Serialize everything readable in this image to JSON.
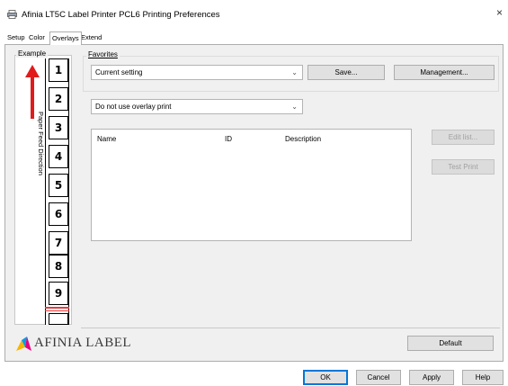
{
  "window": {
    "title": "Afinia LT5C Label Printer PCL6 Printing Preferences",
    "close_glyph": "×",
    "icon": "printer-icon"
  },
  "tabs": [
    {
      "label": "Setup",
      "active": false
    },
    {
      "label": "Color",
      "active": false
    },
    {
      "label": "Overlays",
      "active": true
    },
    {
      "label": "Extend",
      "active": false
    }
  ],
  "example": {
    "label": "Example",
    "feed_direction": "Paper Feed Direction",
    "labels": [
      "1",
      "2",
      "3",
      "4",
      "5",
      "6",
      "7",
      "8",
      "9"
    ],
    "arrow_color": "#e01b1b"
  },
  "favorites": {
    "legend": "Favorites",
    "selected": "Current setting",
    "save_label": "Save...",
    "management_label": "Management..."
  },
  "overlay": {
    "selected": "Do not use overlay print"
  },
  "list": {
    "columns": [
      "Name",
      "ID",
      "Description"
    ],
    "rows": []
  },
  "buttons": {
    "edit_list": "Edit list...",
    "test_print": "Test Print",
    "default": "Default",
    "ok": "OK",
    "cancel": "Cancel",
    "apply": "Apply",
    "help": "Help"
  },
  "logo": {
    "text": "AFINIA LABEL",
    "colors": [
      "#f7b500",
      "#e6007e",
      "#00a0e9"
    ]
  },
  "colors": {
    "accent": "#0078d7",
    "panel": "#f0f0f0"
  }
}
